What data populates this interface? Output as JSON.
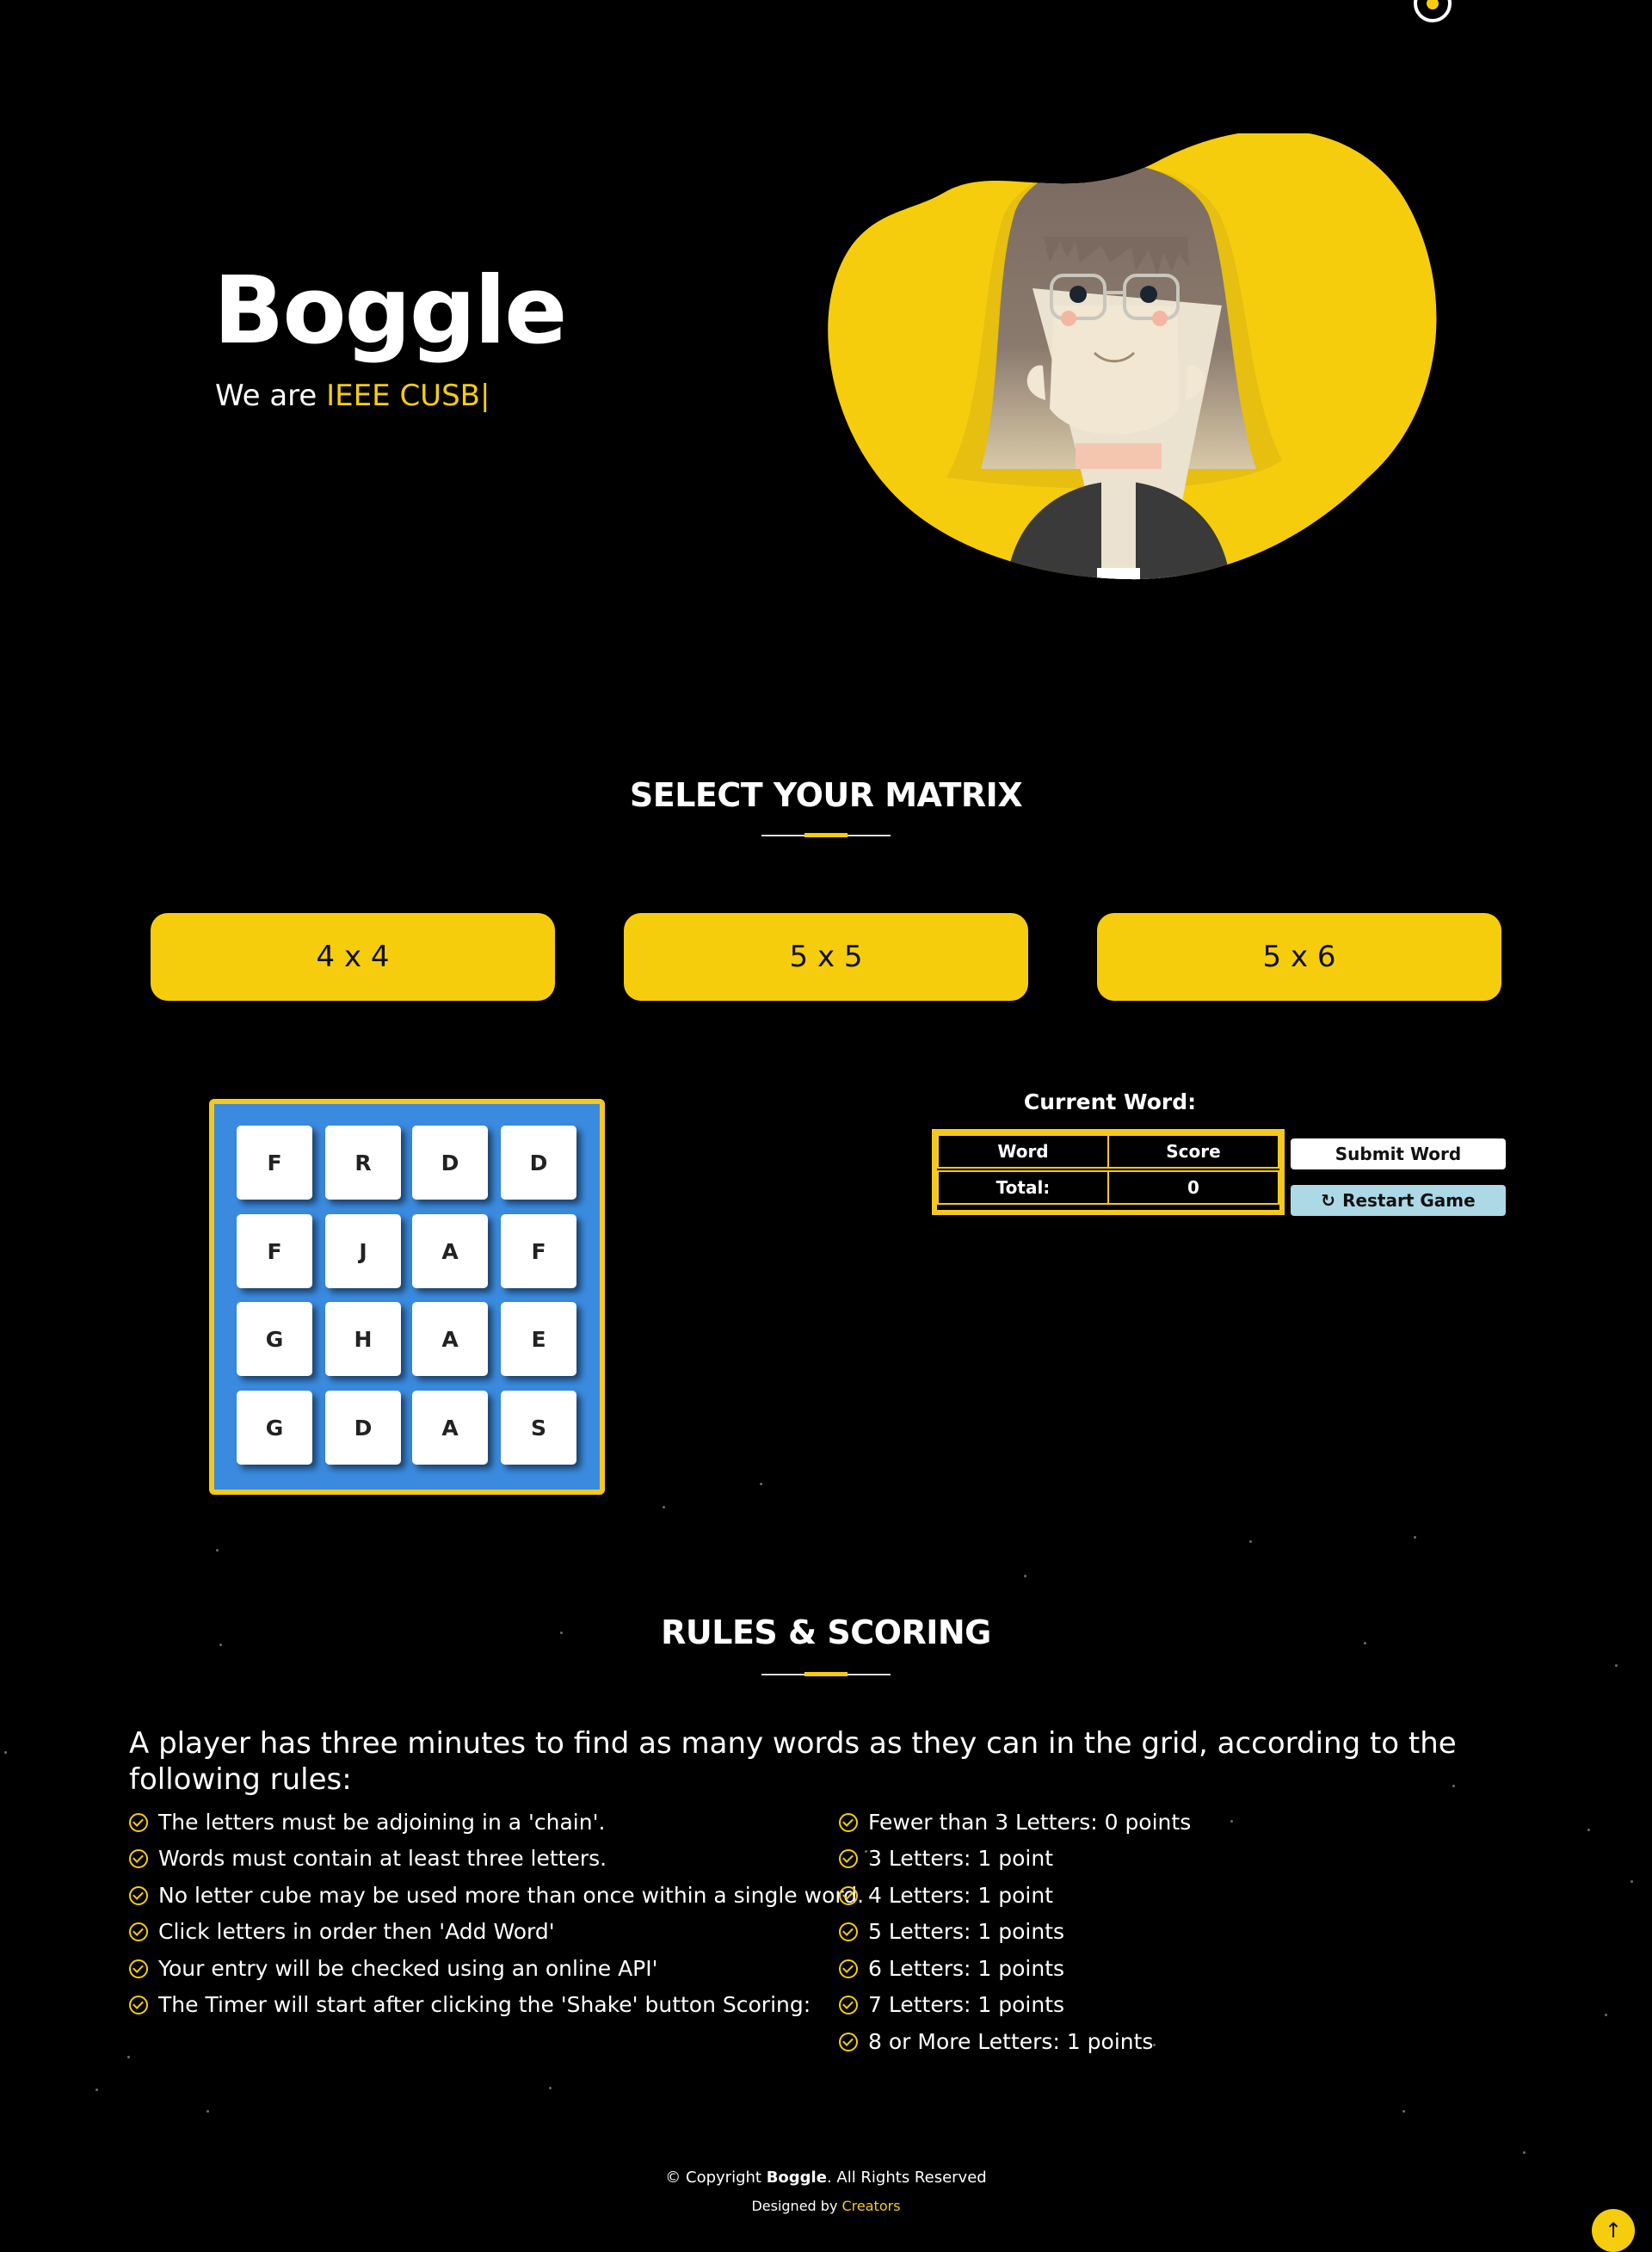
{
  "hero": {
    "title": "Boggle",
    "subtitle_prefix": "We are ",
    "subtitle_highlight": "IEEE CUSB",
    "cursor": "|"
  },
  "matrix": {
    "title": "SELECT YOUR MATRIX",
    "options": [
      "4 x 4",
      "5 x 5",
      "5 x 6"
    ]
  },
  "board": {
    "rows": [
      [
        "F",
        "R",
        "D",
        "D"
      ],
      [
        "F",
        "J",
        "A",
        "F"
      ],
      [
        "G",
        "H",
        "A",
        "E"
      ],
      [
        "G",
        "D",
        "A",
        "S"
      ]
    ]
  },
  "game": {
    "current_word_label": "Current Word:",
    "table": {
      "header_word": "Word",
      "header_score": "Score",
      "total_label": "Total:",
      "total_value": "0"
    },
    "submit_label": "Submit Word",
    "restart_label": "Restart Game"
  },
  "rules": {
    "title": "RULES & SCORING",
    "intro": "A player has three minutes to find as many words as they can in the grid, according to the following rules:",
    "left": [
      "The letters must be adjoining in a 'chain'.",
      "Words must contain at least three letters.",
      "No letter cube may be used more than once within a single word.",
      "Click letters in order then 'Add Word'",
      "Your entry will be checked using an online API'",
      "The Timer will start after clicking the 'Shake' button Scoring:"
    ],
    "right": [
      "Fewer than 3 Letters: 0 points",
      "3 Letters: 1 point",
      "4 Letters: 1 point",
      "5 Letters: 1 points",
      "6 Letters: 1 points",
      "7 Letters: 1 points",
      "8 or More Letters: 1 points"
    ]
  },
  "footer": {
    "copy_prefix": "© Copyright ",
    "copy_brand": "Boggle",
    "copy_suffix": ". All Rights Reserved",
    "designed_prefix": "Designed by ",
    "designed_link": "Creators",
    "to_top_icon": "↑"
  },
  "icons": {
    "nav": "menu-ring-icon",
    "check": "check-circle-icon",
    "restart": "refresh-icon",
    "to_top": "arrow-up-icon"
  },
  "colors": {
    "accent": "#f5cd0d",
    "board": "#3a8be0",
    "restart_button": "#add8e6"
  }
}
